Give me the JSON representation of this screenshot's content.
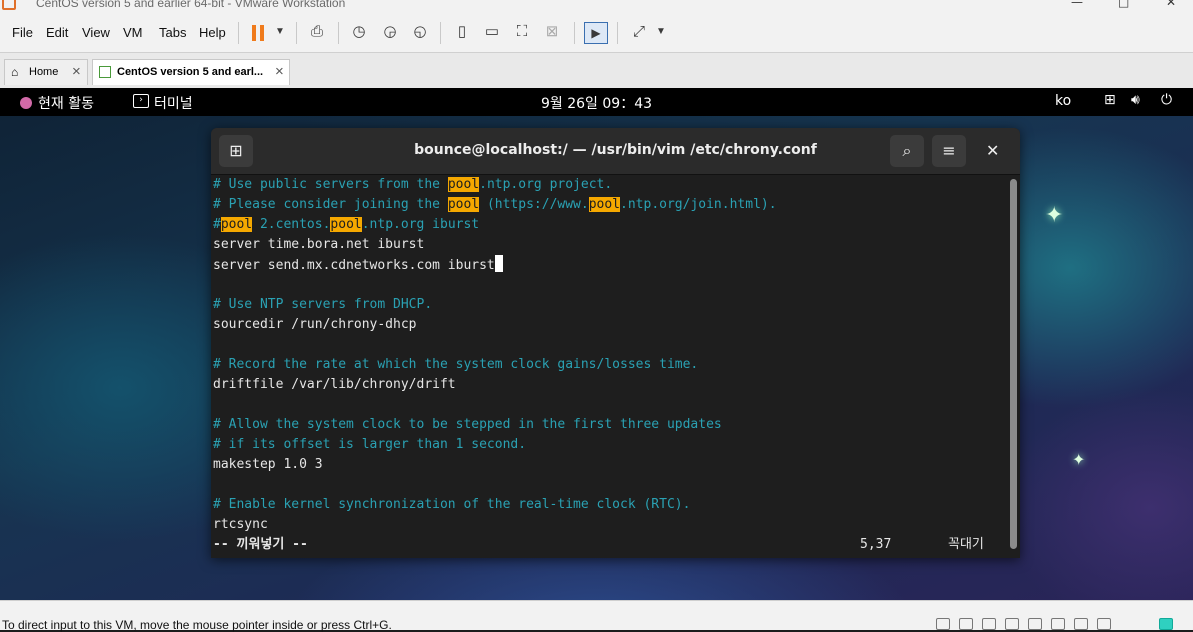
{
  "window": {
    "title": "CentOS version 5 and earlier 64-bit - VMware Workstation",
    "controls": [
      "—",
      "□",
      "✕"
    ]
  },
  "menu": [
    "File",
    "Edit",
    "View",
    "VM",
    "Tabs",
    "Help"
  ],
  "tabs": [
    {
      "label": "Home",
      "icon": "home-icon"
    },
    {
      "label": "CentOS version 5 and earl...",
      "icon": "vm-icon"
    }
  ],
  "gnome": {
    "activities": "현재 활동",
    "app": "터미널",
    "clock": "9월 26일  09：43",
    "lang": "ko"
  },
  "terminal": {
    "title": "bounce@localhost:/ — /usr/bin/vim /etc/chrony.conf",
    "lines": [
      {
        "text": "# Use public servers from the pool.ntp.org project."
      },
      {
        "text": "# Please consider joining the pool (https://www.pool.ntp.org/join.html)."
      },
      {
        "text": "#pool 2.centos.pool.ntp.org iburst"
      },
      {
        "text": "server time.bora.net iburst"
      },
      {
        "text": "server send.mx.cdnetworks.com iburst"
      },
      {
        "text": ""
      },
      {
        "text": "# Use NTP servers from DHCP."
      },
      {
        "text": "sourcedir /run/chrony-dhcp"
      },
      {
        "text": ""
      },
      {
        "text": "# Record the rate at which the system clock gains/losses time."
      },
      {
        "text": "driftfile /var/lib/chrony/drift"
      },
      {
        "text": ""
      },
      {
        "text": "# Allow the system clock to be stepped in the first three updates"
      },
      {
        "text": "# if its offset is larger than 1 second."
      },
      {
        "text": "makestep 1.0 3"
      },
      {
        "text": ""
      },
      {
        "text": "# Enable kernel synchronization of the real-time clock (RTC)."
      },
      {
        "text": "rtcsync"
      }
    ],
    "highlight_word": "pool",
    "status_mode": "-- 끼워넣기 --",
    "status_pos": "5,37",
    "status_scroll": "꼭대기"
  },
  "statusbar": {
    "message": "To direct input to this VM, move the mouse pointer inside or press Ctrl+G."
  },
  "colors": {
    "comment": "#2aa1b3",
    "highlight": "#f5a800",
    "accent": "#f07b1c"
  }
}
